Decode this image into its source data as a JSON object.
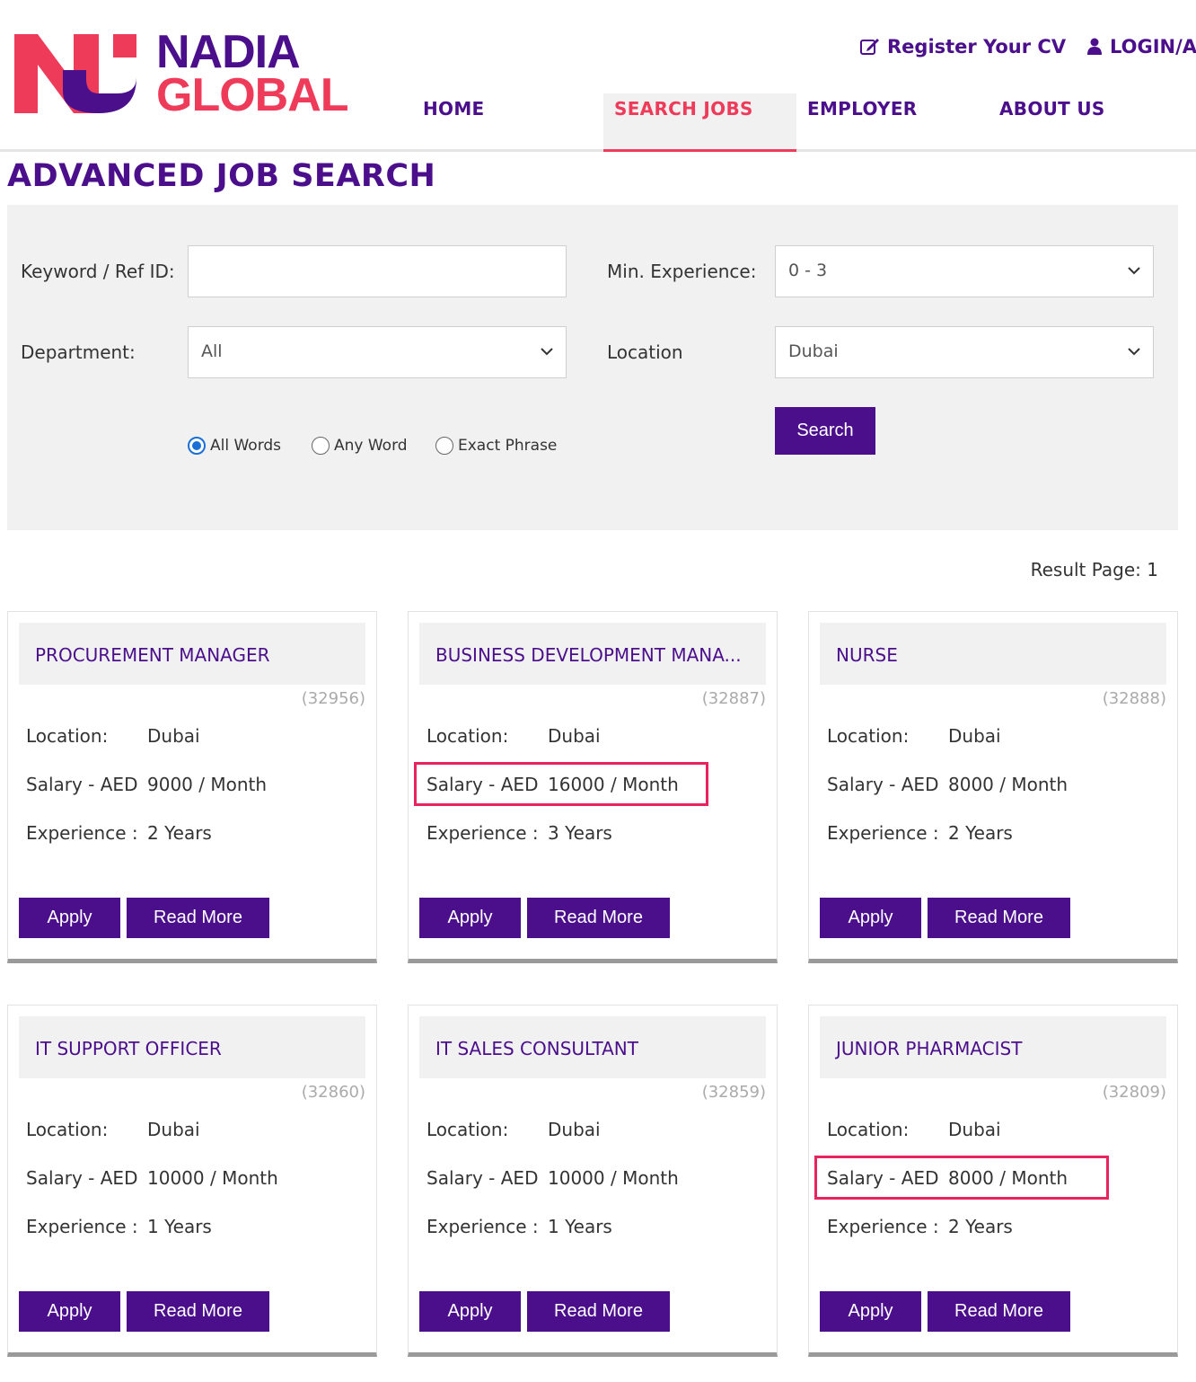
{
  "logo": {
    "line1": "NADIA",
    "line2": "GLOBAL"
  },
  "top_links": {
    "register": "Register Your CV",
    "login": "LOGIN/Ap"
  },
  "nav": [
    "HOME",
    "SEARCH JOBS",
    "EMPLOYER",
    "ABOUT US"
  ],
  "colors": {
    "brand_purple": "#4b0f8c",
    "brand_pink": "#ef3b5a",
    "highlight": "#e8245f"
  },
  "page_title": "ADVANCED JOB SEARCH",
  "search": {
    "keyword_label": "Keyword / Ref ID:",
    "keyword_value": "",
    "experience_label": "Min. Experience:",
    "experience_value": "0 - 3",
    "department_label": "Department:",
    "department_value": "All",
    "location_label": "Location",
    "location_value": "Dubai",
    "radios": [
      "All Words",
      "Any Word",
      "Exact Phrase"
    ],
    "radio_selected": "All Words",
    "button": "Search"
  },
  "result_page": "Result Page: 1",
  "card_labels": {
    "location": "Location:",
    "salary": "Salary - AED",
    "experience": "Experience :",
    "apply": "Apply",
    "read_more": "Read More"
  },
  "jobs": [
    {
      "title": "PROCUREMENT MANAGER",
      "id": "(32956)",
      "location": "Dubai",
      "salary": "9000 / Month",
      "experience": "2 Years",
      "highlighted": false
    },
    {
      "title": "BUSINESS DEVELOPMENT MANA...",
      "id": "(32887)",
      "location": "Dubai",
      "salary": "16000 / Month",
      "experience": "3 Years",
      "highlighted": true
    },
    {
      "title": "NURSE",
      "id": "(32888)",
      "location": "Dubai",
      "salary": "8000 / Month",
      "experience": "2 Years",
      "highlighted": false
    },
    {
      "title": "IT SUPPORT OFFICER",
      "id": "(32860)",
      "location": "Dubai",
      "salary": "10000 / Month",
      "experience": "1 Years",
      "highlighted": false
    },
    {
      "title": "IT SALES CONSULTANT",
      "id": "(32859)",
      "location": "Dubai",
      "salary": "10000 / Month",
      "experience": "1 Years",
      "highlighted": false
    },
    {
      "title": "JUNIOR PHARMACIST",
      "id": "(32809)",
      "location": "Dubai",
      "salary": "8000 / Month",
      "experience": "2 Years",
      "highlighted": true
    }
  ]
}
